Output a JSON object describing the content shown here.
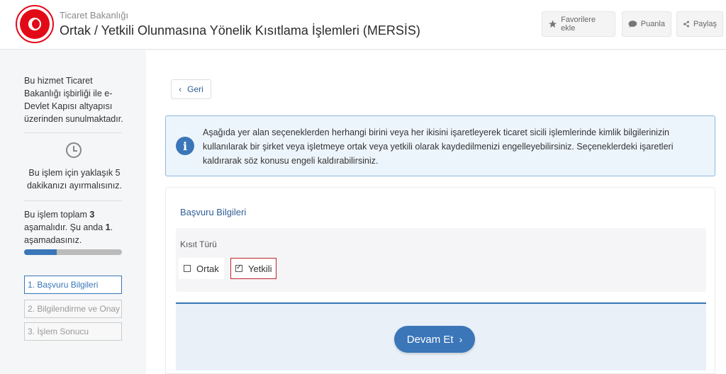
{
  "header": {
    "org": "Ticaret Bakanlığı",
    "title": "Ortak / Yetkili Olunmasına Yönelik Kısıtlama İşlemleri (MERSİS)",
    "buttons": {
      "favorite": "Favorilere ekle",
      "rate": "Puanla",
      "share": "Paylaş"
    }
  },
  "sidebar": {
    "service_note": "Bu hizmet Ticaret Bakanlığı işbirliği ile e-Devlet Kapısı altyapısı üzerinden sunulmaktadır.",
    "time_note": "Bu işlem için yaklaşık 5 dakikanızı ayırmalısınız.",
    "stage_note_prefix": "Bu işlem toplam ",
    "stage_total": "3",
    "stage_note_middle": " aşamalıdır. Şu anda ",
    "stage_current": "1",
    "stage_note_suffix": ". aşamadasınız.",
    "progress_fraction": 0.33,
    "steps": [
      {
        "label": "1. Başvuru Bilgileri",
        "active": true
      },
      {
        "label": "2. Bilgilendirme ve Onay",
        "active": false
      },
      {
        "label": "3. İşlem Sonucu",
        "active": false
      }
    ]
  },
  "main": {
    "back_label": "Geri",
    "info_text": "Aşağıda yer alan seçeneklerden herhangi birini veya her ikisini işaretleyerek ticaret sicili işlemlerinde kimlik bilgilerinizin kullanılarak bir şirket veya işletmeye ortak veya yetkili olarak kaydedilmenizi engelleyebilirsiniz. Seçeneklerdeki işaretleri kaldırarak söz konusu engeli kaldırabilirsiniz.",
    "section_title": "Başvuru Bilgileri",
    "field_label": "Kısıt Türü",
    "options": [
      {
        "label": "Ortak",
        "checked": false
      },
      {
        "label": "Yetkili",
        "checked": true
      }
    ],
    "submit_label": "Devam Et"
  },
  "colors": {
    "accent": "#3a76b8",
    "brand_red": "#e30a17",
    "highlight_border": "#c0222b"
  }
}
